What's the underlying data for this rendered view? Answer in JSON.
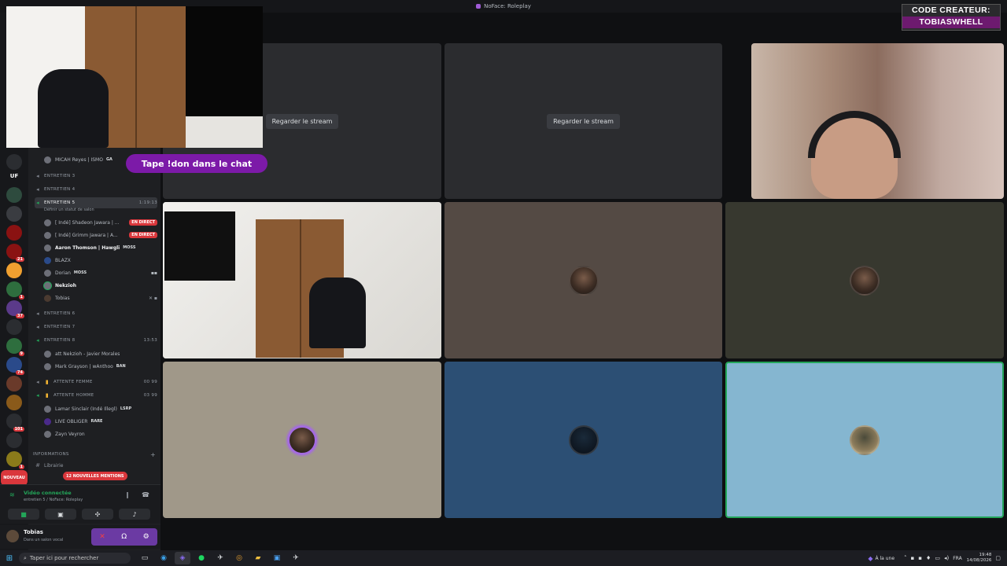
{
  "window": {
    "title": "NoFace: Roleplay"
  },
  "overlay": {
    "donate_text": "Tape !don dans le chat",
    "creator_code_line1": "CODE CREATEUR:",
    "creator_code_line2": "TOBIASWHELL"
  },
  "rail": {
    "servers": [
      {
        "label": "UF",
        "badge": ""
      },
      {
        "label": "",
        "badge": ""
      },
      {
        "label": "",
        "badge": ""
      },
      {
        "label": "",
        "badge": ""
      },
      {
        "label": "",
        "badge": "21"
      },
      {
        "label": "",
        "badge": ""
      },
      {
        "label": "",
        "badge": "1"
      },
      {
        "label": "",
        "badge": "37"
      },
      {
        "label": "",
        "badge": ""
      },
      {
        "label": "",
        "badge": "9"
      },
      {
        "label": "",
        "badge": "74"
      },
      {
        "label": "",
        "badge": ""
      },
      {
        "label": "",
        "badge": ""
      },
      {
        "label": "",
        "badge": "101"
      },
      {
        "label": "",
        "badge": ""
      },
      {
        "label": "",
        "badge": "1"
      }
    ],
    "new_label": "NOUVEAU"
  },
  "sidebar": {
    "top_user": {
      "name": "MICAH Reyes | ISMO",
      "tag": "GA"
    },
    "channels_a": [
      {
        "name": "ENTRETIEN 3",
        "right": ""
      },
      {
        "name": "ENTRETIEN 4",
        "right": ""
      }
    ],
    "selected_channel": {
      "name": "ENTRETIEN 5",
      "time": "1:19:13",
      "status": "Définir un statut de salon"
    },
    "entretien5_users": [
      {
        "name": "[ Indé] Shadeon Jawara | ...",
        "tag": "",
        "live": "EN DIRECT"
      },
      {
        "name": "[ Indé] Grimm Jawara | A...",
        "tag": "",
        "live": "EN DIRECT"
      },
      {
        "name": "Aaron Thomson | Hawgli",
        "tag": "MOSS",
        "live": ""
      },
      {
        "name": "BLAZX",
        "tag": "",
        "live": ""
      },
      {
        "name": "Dorian",
        "tag": "MOSS",
        "live": ""
      },
      {
        "name": "Nekzioh",
        "tag": "",
        "live": ""
      },
      {
        "name": "Tobias",
        "tag": "",
        "live": ""
      }
    ],
    "channels_b": [
      {
        "name": "ENTRETIEN 6",
        "right": ""
      },
      {
        "name": "ENTRETIEN 7",
        "right": ""
      },
      {
        "name": "ENTRETIEN 8",
        "right": "13:53"
      }
    ],
    "entretien8_users": [
      {
        "name": "att Nekzioh - Javier Morales",
        "tag": ""
      },
      {
        "name": "Mark Grayson | wAnthoo",
        "tag": "BAN"
      }
    ],
    "channels_c": [
      {
        "name": "ATTENTE FEMME",
        "right": "00  99"
      },
      {
        "name": "ATTENTE HOMME",
        "right": "03  99"
      }
    ],
    "attente_users": [
      {
        "name": "Lamar Sinclair (Indé Illegl)",
        "tag": "LSRP"
      },
      {
        "name": "LIVE OBLIGER",
        "tag": "RARE"
      },
      {
        "name": "Zayn Veyron",
        "tag": ""
      }
    ],
    "category": "INFORMATIONS",
    "info_channel": "Librairie",
    "mentions": "12 NOUVELLES MENTIONS"
  },
  "voice": {
    "status": "Vidéo connectée",
    "channel": "entretien 5 / NoFace: Roleplay"
  },
  "user": {
    "name": "Tobias",
    "status": "Dans un salon vocal"
  },
  "grid": {
    "stream_button": "Regarder le stream"
  },
  "taskbar": {
    "search_placeholder": "Taper ici pour rechercher",
    "news": "À la une",
    "lang": "FRA",
    "time": "19:48",
    "date": "14/08/2026"
  },
  "colors": {
    "accent": "#a05bd6",
    "live_red": "#da373c",
    "connected_green": "#23a559",
    "tile_brown": "#544a44",
    "tile_grey": "#37382f",
    "tile_beige": "#a09889",
    "tile_navy": "#2c4f74",
    "tile_sky": "#85b6d0"
  }
}
